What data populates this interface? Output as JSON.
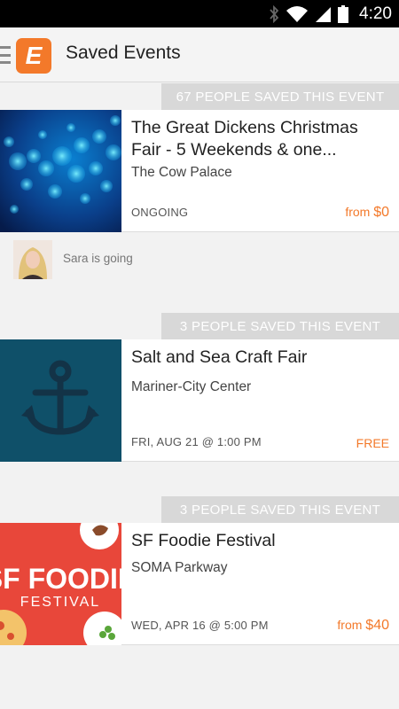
{
  "status_bar": {
    "time": "4:20",
    "icons": [
      "bluetooth-icon",
      "wifi-icon",
      "signal-icon",
      "battery-icon"
    ]
  },
  "app_bar": {
    "logo_letter": "E",
    "title": "Saved Events"
  },
  "events": [
    {
      "saved_count_text": "67 PEOPLE SAVED THIS EVENT",
      "title": "The Great Dickens Christmas Fair - 5 Weekends & one...",
      "venue": "The Cow Palace",
      "date": "ONGOING",
      "price_prefix": "from ",
      "price": "$0"
    },
    {
      "saved_count_text": "3 PEOPLE SAVED THIS EVENT",
      "title": "Salt and Sea Craft Fair",
      "venue": "Mariner-City Center",
      "date": "FRI, AUG 21 @ 1:00 PM",
      "price_prefix": "",
      "price": "FREE"
    },
    {
      "saved_count_text": "3 PEOPLE SAVED THIS EVENT",
      "title": "SF Foodie Festival",
      "venue": "SOMA Parkway",
      "date": "WED, APR 16 @ 5:00 PM",
      "price_prefix": "from ",
      "price": "$40",
      "image_text_main": "SF FOODIE",
      "image_text_sub": "FESTIVAL"
    }
  ],
  "friend_activity": {
    "text": "Sara is going"
  },
  "colors": {
    "accent": "#f3792a",
    "banner": "#d8d8d8",
    "anchor_bg": "#0f5069",
    "anchor_fg": "#133347",
    "foodie_bg": "#e8473a"
  }
}
